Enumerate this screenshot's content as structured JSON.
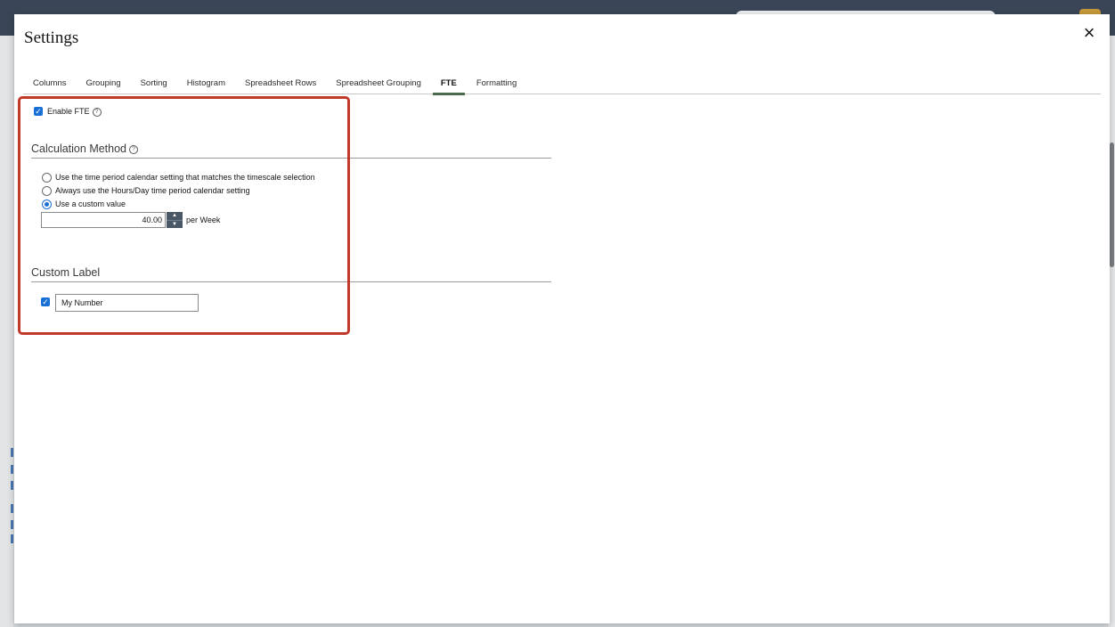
{
  "dialog": {
    "title": "Settings",
    "close_glyph": "×"
  },
  "tabs": [
    {
      "label": "Columns",
      "active": false
    },
    {
      "label": "Grouping",
      "active": false
    },
    {
      "label": "Sorting",
      "active": false
    },
    {
      "label": "Histogram",
      "active": false
    },
    {
      "label": "Spreadsheet Rows",
      "active": false
    },
    {
      "label": "Spreadsheet Grouping",
      "active": false
    },
    {
      "label": "FTE",
      "active": true
    },
    {
      "label": "Formatting",
      "active": false
    }
  ],
  "fte": {
    "enable_label": "Enable FTE",
    "enable_checked": true,
    "help_glyph": "?",
    "check_glyph": "✓"
  },
  "calculation": {
    "title": "Calculation Method",
    "options": [
      {
        "label": "Use the time period calendar setting that matches the timescale selection",
        "checked": false
      },
      {
        "label": "Always use the Hours/Day time period calendar setting",
        "checked": false
      },
      {
        "label": "Use a custom value",
        "checked": true
      }
    ],
    "custom_value": "40.00",
    "unit_label": "per Week",
    "up_glyph": "▲",
    "down_glyph": "▼"
  },
  "custom_label": {
    "title": "Custom Label",
    "checked": true,
    "value": "My Number"
  },
  "colors": {
    "accent": "#1a6fd6",
    "highlight": "#c0392b",
    "tab_underline": "#4a6b4e"
  }
}
